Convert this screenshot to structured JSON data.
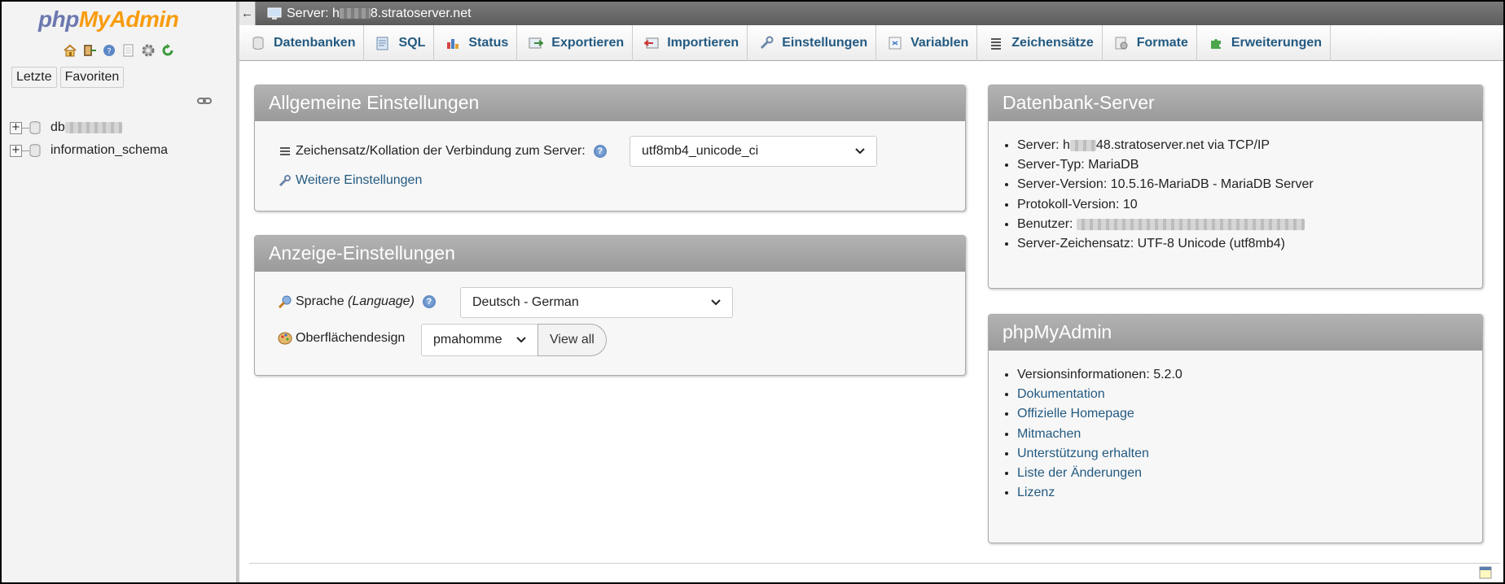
{
  "nav": {
    "logo_part1": "php",
    "logo_part2": "MyAdmin",
    "icons": [
      "home-icon",
      "exit-icon",
      "help-icon",
      "docs-icon",
      "settings-icon",
      "reload-icon"
    ],
    "tabs": [
      "Letzte",
      "Favoriten"
    ],
    "databases": [
      {
        "label": "db",
        "redacted": true
      },
      {
        "label": "information_schema",
        "redacted": false
      }
    ]
  },
  "serverbar": {
    "collapse": "←",
    "prefix": "Server: h",
    "suffix": "8.stratoserver.net"
  },
  "menu": [
    {
      "label": "Datenbanken",
      "icon": "database-icon"
    },
    {
      "label": "SQL",
      "icon": "sql-icon"
    },
    {
      "label": "Status",
      "icon": "status-icon"
    },
    {
      "label": "Exportieren",
      "icon": "export-icon"
    },
    {
      "label": "Importieren",
      "icon": "import-icon"
    },
    {
      "label": "Einstellungen",
      "icon": "wrench-icon"
    },
    {
      "label": "Variablen",
      "icon": "variables-icon"
    },
    {
      "label": "Zeichensätze",
      "icon": "charset-icon"
    },
    {
      "label": "Formate",
      "icon": "engines-icon"
    },
    {
      "label": "Erweiterungen",
      "icon": "plugin-icon"
    }
  ],
  "general": {
    "title": "Allgemeine Einstellungen",
    "collation_label": "Zeichensatz/Kollation der Verbindung zum Server:",
    "collation_value": "utf8mb4_unicode_ci",
    "more_settings": "Weitere Einstellungen"
  },
  "display": {
    "title": "Anzeige-Einstellungen",
    "language_label": "Sprache",
    "language_label_en": "(Language)",
    "language_value": "Deutsch - German",
    "theme_label": "Oberflächendesign",
    "theme_value": "pmahomme",
    "view_all": "View all"
  },
  "dbserver": {
    "title": "Datenbank-Server",
    "server_prefix": "Server: h",
    "server_suffix": "48.stratoserver.net via TCP/IP",
    "server_type": "Server-Typ: MariaDB",
    "server_version": "Server-Version: 10.5.16-MariaDB - MariaDB Server",
    "protocol": "Protokoll-Version: 10",
    "user_label": "Benutzer:",
    "charset": "Server-Zeichensatz: UTF-8 Unicode (utf8mb4)"
  },
  "pma": {
    "title": "phpMyAdmin",
    "version": "Versionsinformationen: 5.2.0",
    "links": [
      "Dokumentation",
      "Offizielle Homepage",
      "Mitmachen",
      "Unterstützung erhalten",
      "Liste der Änderungen",
      "Lizenz"
    ]
  }
}
